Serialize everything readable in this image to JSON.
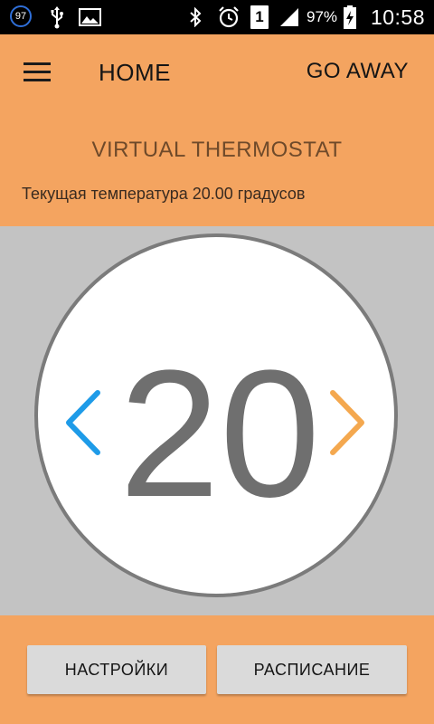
{
  "status_bar": {
    "notification_count": "97",
    "battery_percent": "97%",
    "sim_slot": "1",
    "time": "10:58",
    "icons": [
      "notification-badge-icon",
      "usb-icon",
      "image-icon",
      "bluetooth-icon",
      "alarm-icon",
      "sim-icon",
      "signal-icon",
      "battery-charging-icon"
    ]
  },
  "app_bar": {
    "menu_icon": "hamburger-menu-icon",
    "title": "HOME",
    "go_away_label": "GO AWAY"
  },
  "header": {
    "title": "VIRTUAL THERMOSTAT",
    "current_temperature_text": "Текущая температура 20.00 градусов"
  },
  "dial": {
    "target_temperature": "20",
    "decrease_icon": "chevron-left-icon",
    "increase_icon": "chevron-right-icon"
  },
  "footer": {
    "settings_label": "НАСТРОЙКИ",
    "schedule_label": "РАСПИСАНИЕ"
  },
  "colors": {
    "accent": "#f4a460",
    "dial_background": "#c3c3c3",
    "decrease_arrow": "#1e9be8",
    "increase_arrow": "#f4a84f",
    "temperature_text": "#6f6f6f"
  }
}
